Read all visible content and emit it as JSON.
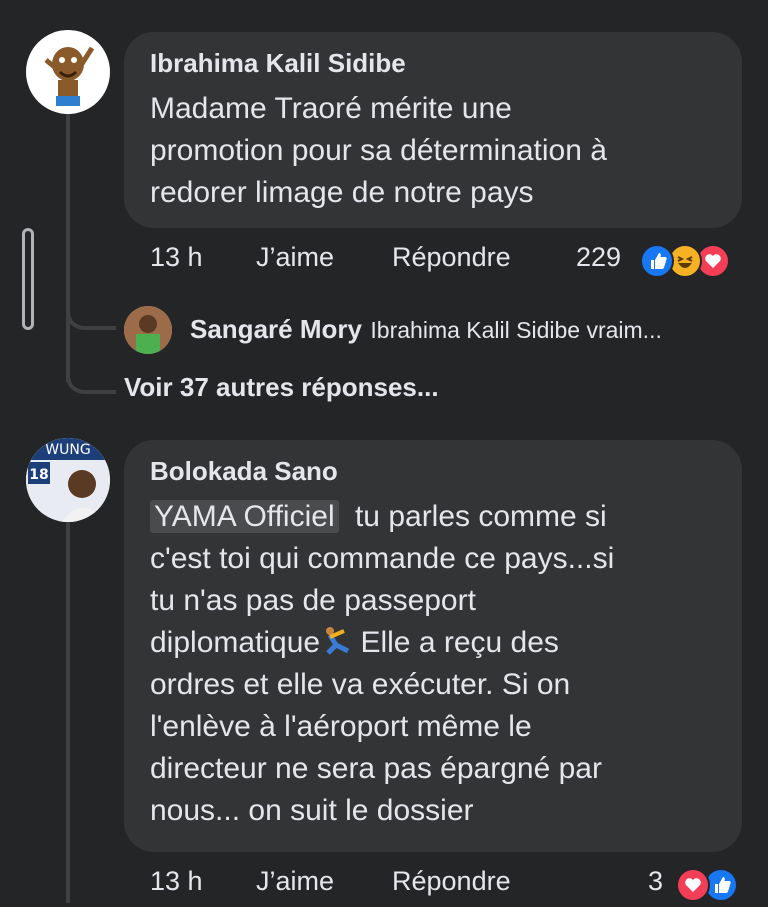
{
  "comments": [
    {
      "author": "Ibrahima Kalil Sidibe",
      "lines": [
        "Madame Traoré mérite une",
        "promotion pour sa détermination à",
        "redorer limage de notre pays"
      ],
      "time": "13 h",
      "like_label": "J’aime",
      "reply_label": "Répondre",
      "reaction_count": "229",
      "reactions": [
        "like-icon",
        "haha-icon",
        "love-icon"
      ],
      "reply_preview": {
        "author": "Sangaré Mory",
        "text": "Ibrahima Kalil Sidibe vraim..."
      },
      "more_replies": "Voir 37 autres réponses..."
    },
    {
      "author": "Bolokada Sano",
      "mention": "YAMA Officiel",
      "line1_rest": "tu parles comme si",
      "lines": [
        "c'est toi qui commande ce pays...si",
        "tu n'as pas de passeport"
      ],
      "line4_start": "diplomatique",
      "line4_emoji": "dancing-person-emoji",
      "line4_end": " Elle a reçu des",
      "lines_after": [
        "ordres et elle va exécuter. Si on",
        "l'enlève à l'aéroport même le",
        "directeur ne sera pas épargné par",
        "nous... on suit le dossier"
      ],
      "avatar_text": "18",
      "time": "13 h",
      "like_label": "J’aime",
      "reply_label": "Répondre",
      "reaction_count": "3",
      "reactions": [
        "love-icon",
        "like-icon"
      ]
    }
  ],
  "colors": {
    "background": "#242526",
    "bubble": "#333436",
    "text": "#e4e6eb",
    "like_blue": "#1877f2",
    "love_red": "#f33e58",
    "haha_yellow": "#f7b125"
  }
}
